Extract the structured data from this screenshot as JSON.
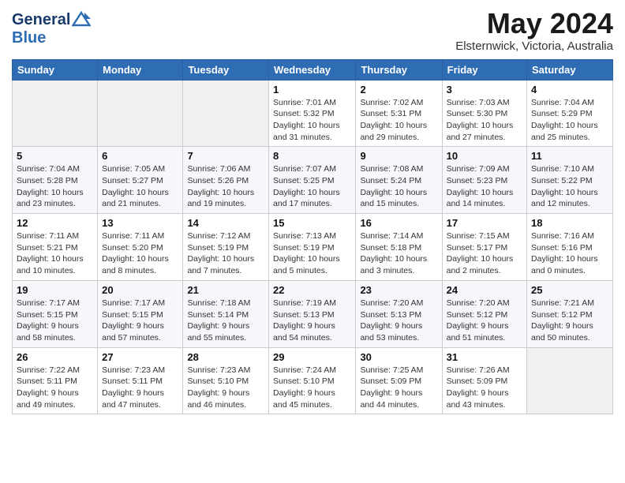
{
  "header": {
    "logo_line1": "General",
    "logo_line2": "Blue",
    "month_title": "May 2024",
    "location": "Elsternwick, Victoria, Australia"
  },
  "weekdays": [
    "Sunday",
    "Monday",
    "Tuesday",
    "Wednesday",
    "Thursday",
    "Friday",
    "Saturday"
  ],
  "weeks": [
    [
      {
        "day": "",
        "info": ""
      },
      {
        "day": "",
        "info": ""
      },
      {
        "day": "",
        "info": ""
      },
      {
        "day": "1",
        "info": "Sunrise: 7:01 AM\nSunset: 5:32 PM\nDaylight: 10 hours\nand 31 minutes."
      },
      {
        "day": "2",
        "info": "Sunrise: 7:02 AM\nSunset: 5:31 PM\nDaylight: 10 hours\nand 29 minutes."
      },
      {
        "day": "3",
        "info": "Sunrise: 7:03 AM\nSunset: 5:30 PM\nDaylight: 10 hours\nand 27 minutes."
      },
      {
        "day": "4",
        "info": "Sunrise: 7:04 AM\nSunset: 5:29 PM\nDaylight: 10 hours\nand 25 minutes."
      }
    ],
    [
      {
        "day": "5",
        "info": "Sunrise: 7:04 AM\nSunset: 5:28 PM\nDaylight: 10 hours\nand 23 minutes."
      },
      {
        "day": "6",
        "info": "Sunrise: 7:05 AM\nSunset: 5:27 PM\nDaylight: 10 hours\nand 21 minutes."
      },
      {
        "day": "7",
        "info": "Sunrise: 7:06 AM\nSunset: 5:26 PM\nDaylight: 10 hours\nand 19 minutes."
      },
      {
        "day": "8",
        "info": "Sunrise: 7:07 AM\nSunset: 5:25 PM\nDaylight: 10 hours\nand 17 minutes."
      },
      {
        "day": "9",
        "info": "Sunrise: 7:08 AM\nSunset: 5:24 PM\nDaylight: 10 hours\nand 15 minutes."
      },
      {
        "day": "10",
        "info": "Sunrise: 7:09 AM\nSunset: 5:23 PM\nDaylight: 10 hours\nand 14 minutes."
      },
      {
        "day": "11",
        "info": "Sunrise: 7:10 AM\nSunset: 5:22 PM\nDaylight: 10 hours\nand 12 minutes."
      }
    ],
    [
      {
        "day": "12",
        "info": "Sunrise: 7:11 AM\nSunset: 5:21 PM\nDaylight: 10 hours\nand 10 minutes."
      },
      {
        "day": "13",
        "info": "Sunrise: 7:11 AM\nSunset: 5:20 PM\nDaylight: 10 hours\nand 8 minutes."
      },
      {
        "day": "14",
        "info": "Sunrise: 7:12 AM\nSunset: 5:19 PM\nDaylight: 10 hours\nand 7 minutes."
      },
      {
        "day": "15",
        "info": "Sunrise: 7:13 AM\nSunset: 5:19 PM\nDaylight: 10 hours\nand 5 minutes."
      },
      {
        "day": "16",
        "info": "Sunrise: 7:14 AM\nSunset: 5:18 PM\nDaylight: 10 hours\nand 3 minutes."
      },
      {
        "day": "17",
        "info": "Sunrise: 7:15 AM\nSunset: 5:17 PM\nDaylight: 10 hours\nand 2 minutes."
      },
      {
        "day": "18",
        "info": "Sunrise: 7:16 AM\nSunset: 5:16 PM\nDaylight: 10 hours\nand 0 minutes."
      }
    ],
    [
      {
        "day": "19",
        "info": "Sunrise: 7:17 AM\nSunset: 5:15 PM\nDaylight: 9 hours\nand 58 minutes."
      },
      {
        "day": "20",
        "info": "Sunrise: 7:17 AM\nSunset: 5:15 PM\nDaylight: 9 hours\nand 57 minutes."
      },
      {
        "day": "21",
        "info": "Sunrise: 7:18 AM\nSunset: 5:14 PM\nDaylight: 9 hours\nand 55 minutes."
      },
      {
        "day": "22",
        "info": "Sunrise: 7:19 AM\nSunset: 5:13 PM\nDaylight: 9 hours\nand 54 minutes."
      },
      {
        "day": "23",
        "info": "Sunrise: 7:20 AM\nSunset: 5:13 PM\nDaylight: 9 hours\nand 53 minutes."
      },
      {
        "day": "24",
        "info": "Sunrise: 7:20 AM\nSunset: 5:12 PM\nDaylight: 9 hours\nand 51 minutes."
      },
      {
        "day": "25",
        "info": "Sunrise: 7:21 AM\nSunset: 5:12 PM\nDaylight: 9 hours\nand 50 minutes."
      }
    ],
    [
      {
        "day": "26",
        "info": "Sunrise: 7:22 AM\nSunset: 5:11 PM\nDaylight: 9 hours\nand 49 minutes."
      },
      {
        "day": "27",
        "info": "Sunrise: 7:23 AM\nSunset: 5:11 PM\nDaylight: 9 hours\nand 47 minutes."
      },
      {
        "day": "28",
        "info": "Sunrise: 7:23 AM\nSunset: 5:10 PM\nDaylight: 9 hours\nand 46 minutes."
      },
      {
        "day": "29",
        "info": "Sunrise: 7:24 AM\nSunset: 5:10 PM\nDaylight: 9 hours\nand 45 minutes."
      },
      {
        "day": "30",
        "info": "Sunrise: 7:25 AM\nSunset: 5:09 PM\nDaylight: 9 hours\nand 44 minutes."
      },
      {
        "day": "31",
        "info": "Sunrise: 7:26 AM\nSunset: 5:09 PM\nDaylight: 9 hours\nand 43 minutes."
      },
      {
        "day": "",
        "info": ""
      }
    ]
  ]
}
